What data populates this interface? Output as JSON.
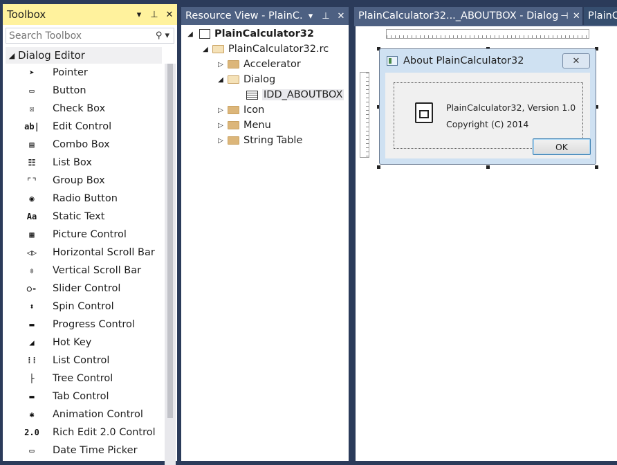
{
  "toolbox": {
    "title": "Toolbox",
    "search_placeholder": "Search Toolbox",
    "group": "Dialog Editor",
    "tools": [
      {
        "label": "Pointer",
        "icon": "pointer-icon",
        "glyph": "➤"
      },
      {
        "label": "Button",
        "icon": "button-icon",
        "glyph": "▭"
      },
      {
        "label": "Check Box",
        "icon": "checkbox-icon",
        "glyph": "☒"
      },
      {
        "label": "Edit Control",
        "icon": "edit-control-icon",
        "glyph": "ab|"
      },
      {
        "label": "Combo Box",
        "icon": "combo-box-icon",
        "glyph": "▤"
      },
      {
        "label": "List Box",
        "icon": "list-box-icon",
        "glyph": "☷"
      },
      {
        "label": "Group Box",
        "icon": "group-box-icon",
        "glyph": "⌜⌝"
      },
      {
        "label": "Radio Button",
        "icon": "radio-button-icon",
        "glyph": "◉"
      },
      {
        "label": "Static Text",
        "icon": "static-text-icon",
        "glyph": "Aa"
      },
      {
        "label": "Picture Control",
        "icon": "picture-control-icon",
        "glyph": "▦"
      },
      {
        "label": "Horizontal Scroll Bar",
        "icon": "hscroll-icon",
        "glyph": "◁▷"
      },
      {
        "label": "Vertical Scroll Bar",
        "icon": "vscroll-icon",
        "glyph": "⇳"
      },
      {
        "label": "Slider Control",
        "icon": "slider-icon",
        "glyph": "○-"
      },
      {
        "label": "Spin Control",
        "icon": "spin-icon",
        "glyph": "⬍"
      },
      {
        "label": "Progress Control",
        "icon": "progress-icon",
        "glyph": "▬"
      },
      {
        "label": "Hot Key",
        "icon": "hotkey-icon",
        "glyph": "◢"
      },
      {
        "label": "List Control",
        "icon": "list-control-icon",
        "glyph": "⁞⁞"
      },
      {
        "label": "Tree Control",
        "icon": "tree-control-icon",
        "glyph": "├"
      },
      {
        "label": "Tab Control",
        "icon": "tab-control-icon",
        "glyph": "▬"
      },
      {
        "label": "Animation Control",
        "icon": "animation-icon",
        "glyph": "✱"
      },
      {
        "label": "Rich Edit 2.0 Control",
        "icon": "rich-edit-icon",
        "glyph": "2.0"
      },
      {
        "label": "Date Time Picker",
        "icon": "date-time-icon",
        "glyph": "▭"
      }
    ]
  },
  "resource_view": {
    "title": "Resource View - PlainC...",
    "tree": {
      "root": "PlainCalculator32",
      "rc": "PlainCalculator32.rc",
      "accelerator": "Accelerator",
      "dialog": "Dialog",
      "dialog_item": "IDD_ABOUTBOX",
      "icon": "Icon",
      "menu": "Menu",
      "string_table": "String Table"
    }
  },
  "document": {
    "tab_active": "PlainCalculator32..._ABOUTBOX - Dialog",
    "tab_inactive": "PlainCa"
  },
  "dialog": {
    "title": "About PlainCalculator32",
    "close": "✕",
    "line1": "PlainCalculator32, Version 1.0",
    "line2": "Copyright (C) 2014",
    "ok": "OK"
  },
  "colors": {
    "toolbox_title_bg": "#fff29d",
    "panel_title_bg": "#4d6082",
    "ide_bg": "#2b3b5a",
    "dialog_frame": "#cfe1f2"
  }
}
